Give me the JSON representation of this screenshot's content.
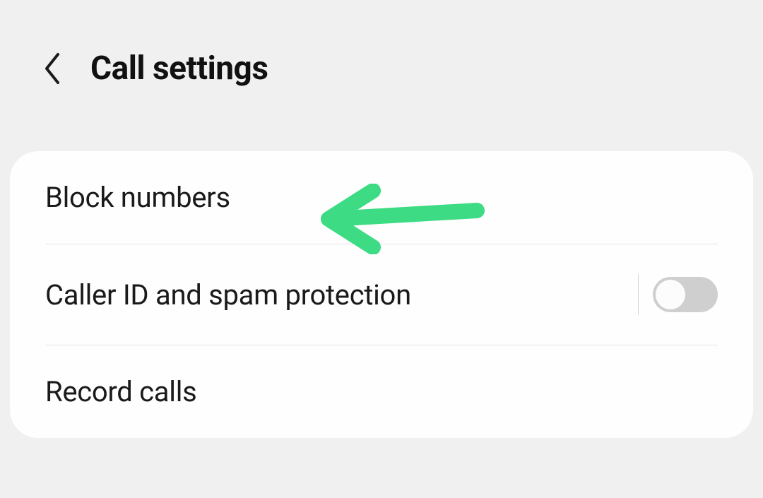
{
  "header": {
    "title": "Call settings"
  },
  "settings": {
    "items": [
      {
        "label": "Block numbers"
      },
      {
        "label": "Caller ID and spam protection",
        "toggle": false
      },
      {
        "label": "Record calls"
      }
    ]
  },
  "annotation": {
    "color": "#3ddc84"
  }
}
